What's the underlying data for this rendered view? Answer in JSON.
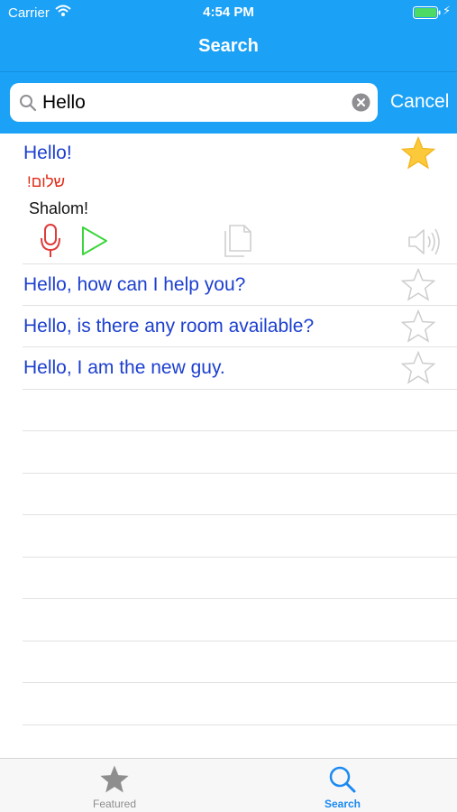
{
  "status_bar": {
    "carrier": "Carrier",
    "time": "4:54 PM"
  },
  "nav": {
    "title": "Search"
  },
  "search": {
    "value": "Hello",
    "cancel_label": "Cancel"
  },
  "results": [
    {
      "phrase": "Hello!",
      "hebrew": "שלום!",
      "transliteration": "Shalom!",
      "favorite": true,
      "expanded": true
    },
    {
      "phrase": "Hello, how can I help you?",
      "favorite": false
    },
    {
      "phrase": "Hello, is there any room available?",
      "favorite": false
    },
    {
      "phrase": "Hello, I am the new guy.",
      "favorite": false
    }
  ],
  "tabs": [
    {
      "label": "Featured",
      "icon": "star-icon",
      "active": false
    },
    {
      "label": "Search",
      "icon": "magnifier-icon",
      "active": true
    }
  ],
  "colors": {
    "header": "#1ba1f5",
    "phrase": "#1c3fcf",
    "hebrew": "#e02814",
    "favorite": "#fcc93a",
    "mic": "#e03a3a",
    "play": "#3ad63a",
    "tab_active": "#1a8af2",
    "tab_inactive": "#8e8e8e"
  }
}
